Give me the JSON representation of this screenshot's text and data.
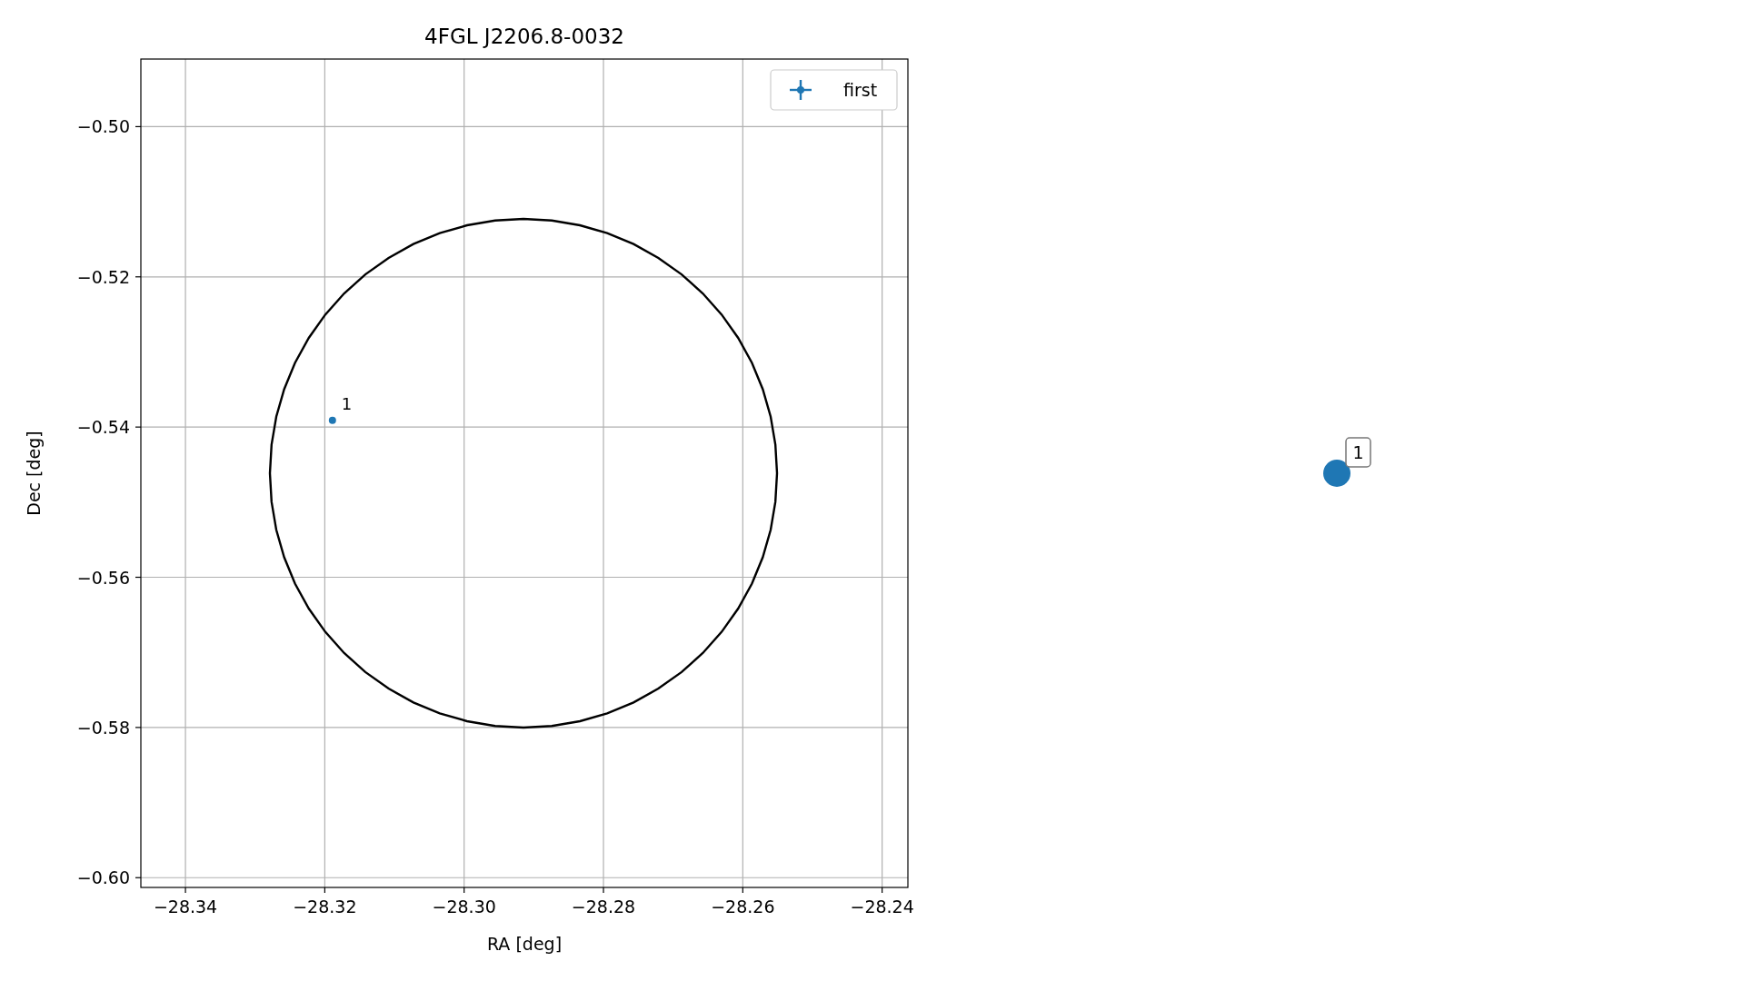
{
  "figure": {
    "chart_data": {
      "type": "scatter",
      "title": "4FGL J2206.8-0032",
      "xlabel": "RA [deg]",
      "ylabel": "Dec [deg]",
      "xlim": [
        -28.3464,
        -28.2363
      ],
      "ylim": [
        -0.6013,
        -0.491
      ],
      "grid": true,
      "xticks": [
        {
          "value": -28.34,
          "label": "−28.34"
        },
        {
          "value": -28.32,
          "label": "−28.32"
        },
        {
          "value": -28.3,
          "label": "−28.30"
        },
        {
          "value": -28.28,
          "label": "−28.28"
        },
        {
          "value": -28.26,
          "label": "−28.26"
        },
        {
          "value": -28.24,
          "label": "−28.24"
        }
      ],
      "yticks": [
        {
          "value": -0.5,
          "label": "−0.50"
        },
        {
          "value": -0.52,
          "label": "−0.52"
        },
        {
          "value": -0.54,
          "label": "−0.54"
        },
        {
          "value": -0.56,
          "label": "−0.56"
        },
        {
          "value": -0.58,
          "label": "−0.58"
        },
        {
          "value": -0.6,
          "label": "−0.60"
        }
      ],
      "x": [
        -28.3189
      ],
      "series": [
        {
          "name": "first",
          "color": "#1f77b4",
          "values": [
            -0.5391
          ]
        }
      ],
      "annotations": [
        {
          "x": -28.3189,
          "y": -0.5391,
          "text": "1"
        }
      ]
    },
    "side_marker": {
      "label": "1",
      "color": "#1f77b4"
    }
  }
}
